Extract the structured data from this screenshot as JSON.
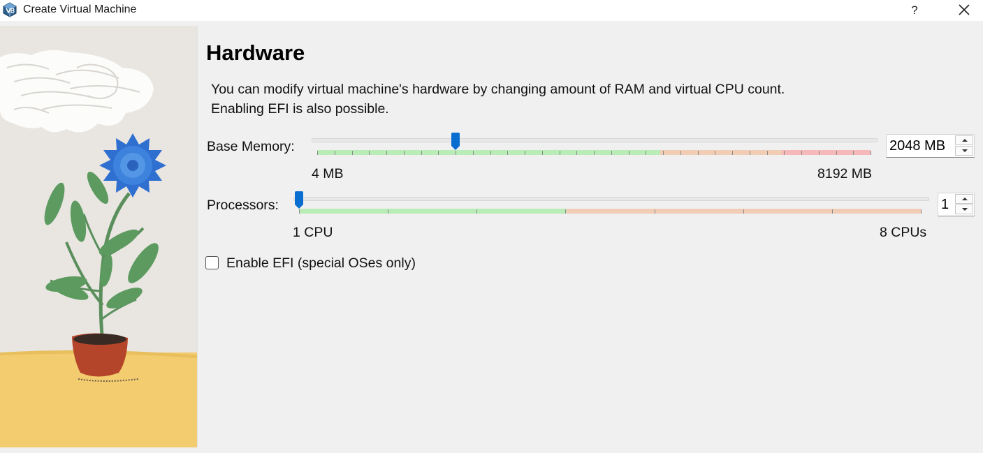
{
  "window": {
    "title": "Create Virtual Machine",
    "help_label": "?",
    "icons": {
      "app": "virtualbox-icon",
      "close": "close-icon"
    }
  },
  "page": {
    "title": "Hardware",
    "description_line1": "You can modify virtual machine's hardware by changing amount of RAM and virtual CPU count.",
    "description_line2": "Enabling EFI is also possible."
  },
  "memory": {
    "label": "Base Memory:",
    "min_label": "4 MB",
    "max_label": "8192 MB",
    "value_text": "2048 MB",
    "value_mb": 2048,
    "min_mb": 4,
    "max_mb": 8192,
    "zones_fraction": {
      "green_end": 0.62,
      "orange_end": 0.84
    },
    "colors": {
      "green": "#b9ecb6",
      "orange": "#f2cdb6",
      "red": "#f5b9b9",
      "handle": "#0a6ed1"
    }
  },
  "processors": {
    "label": "Processors:",
    "min_label": "1 CPU",
    "max_label": "8 CPUs",
    "value_text": "1",
    "value": 1,
    "min": 1,
    "max": 8,
    "zones_fraction": {
      "green_end": 0.43
    },
    "colors": {
      "green": "#b9ecb6",
      "orange": "#f2cdb6",
      "handle": "#0a6ed1"
    }
  },
  "efi": {
    "label": "Enable EFI (special OSes only)",
    "checked": false
  }
}
